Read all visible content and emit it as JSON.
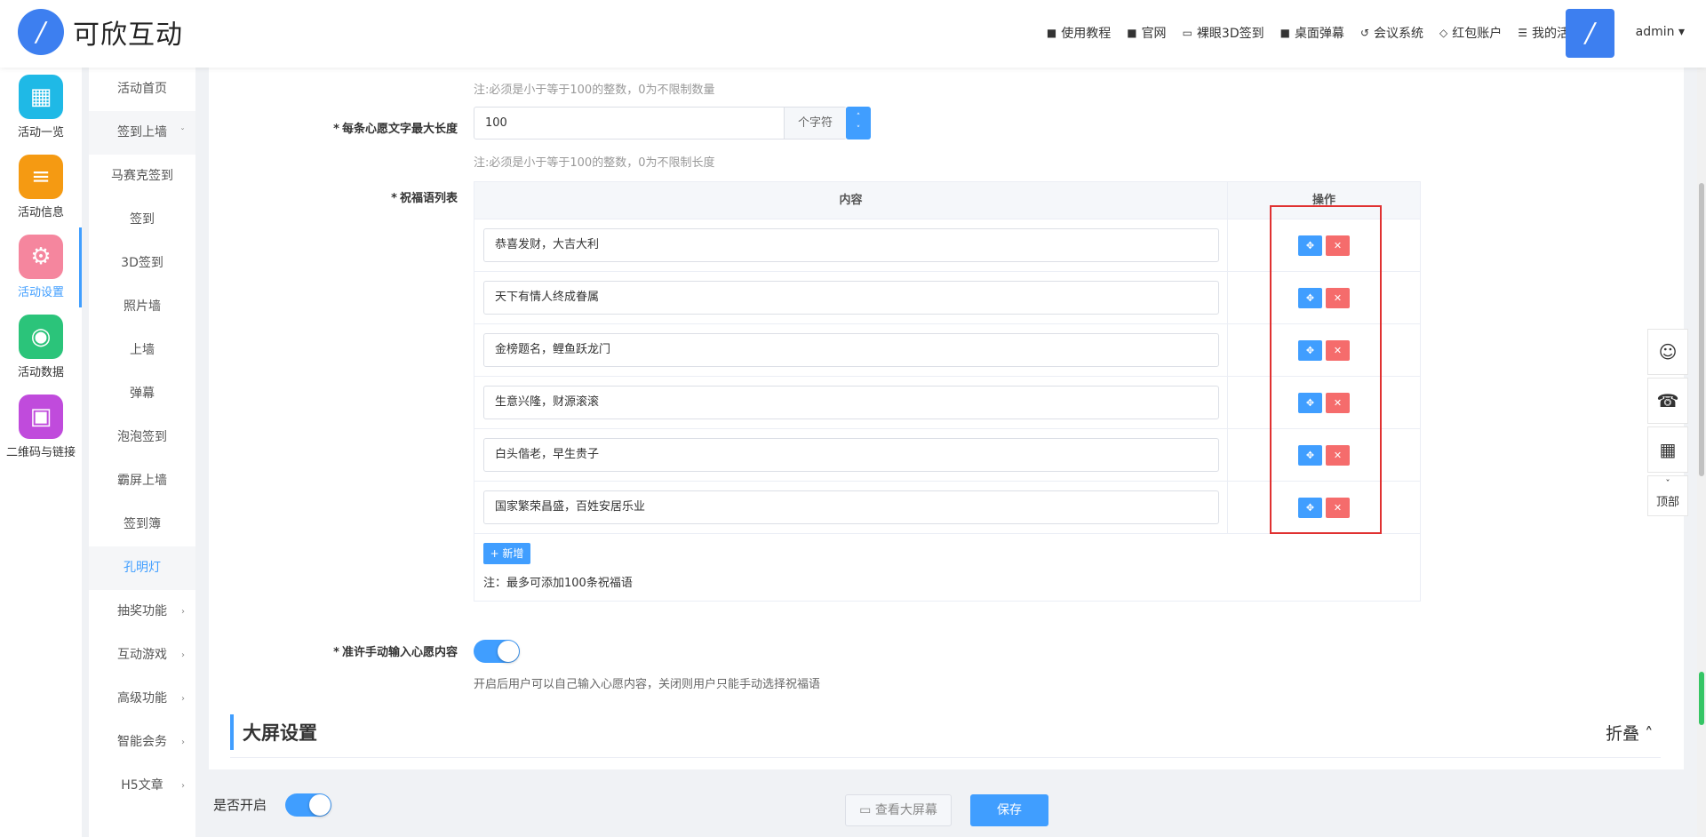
{
  "header": {
    "logo_glyph": "∕",
    "brand": "可欣互动",
    "nav": [
      {
        "icon": "document-icon",
        "glyph": "■",
        "label": "使用教程"
      },
      {
        "icon": "document-icon",
        "glyph": "■",
        "label": "官网"
      },
      {
        "icon": "monitor-icon",
        "glyph": "▭",
        "label": "裸眼3D签到"
      },
      {
        "icon": "document-icon",
        "glyph": "■",
        "label": "桌面弹幕"
      },
      {
        "icon": "meeting-icon",
        "glyph": "↺",
        "label": "会议系统"
      },
      {
        "icon": "diamond-icon",
        "glyph": "◇",
        "label": "红包账户"
      },
      {
        "icon": "list-icon",
        "glyph": "☰",
        "label": "我的活动"
      }
    ],
    "admin": "admin ▾"
  },
  "sidebar1": [
    {
      "label": "活动一览",
      "color": "#1fb9e6",
      "glyph": "▦",
      "icon": "grid-icon"
    },
    {
      "label": "活动信息",
      "color": "#f59a12",
      "glyph": "≡",
      "icon": "document-icon"
    },
    {
      "label": "活动设置",
      "color": "#f5869e",
      "glyph": "⚙",
      "icon": "gear-icon"
    },
    {
      "label": "活动数据",
      "color": "#2bc47a",
      "glyph": "◉",
      "icon": "database-icon"
    },
    {
      "label": "二维码与链接",
      "color": "#c04bdc",
      "glyph": "▣",
      "icon": "qrcode-icon"
    }
  ],
  "sidebar2": [
    {
      "label": "活动首页",
      "arrow": ""
    },
    {
      "label": "签到上墙",
      "arrow": "ˇ"
    },
    {
      "label": "马赛克签到",
      "arrow": ""
    },
    {
      "label": "签到",
      "arrow": ""
    },
    {
      "label": "3D签到",
      "arrow": ""
    },
    {
      "label": "照片墙",
      "arrow": ""
    },
    {
      "label": "上墙",
      "arrow": ""
    },
    {
      "label": "弹幕",
      "arrow": ""
    },
    {
      "label": "泡泡签到",
      "arrow": ""
    },
    {
      "label": "霸屏上墙",
      "arrow": ""
    },
    {
      "label": "签到簿",
      "arrow": ""
    },
    {
      "label": "孔明灯",
      "arrow": ""
    },
    {
      "label": "抽奖功能",
      "arrow": "›"
    },
    {
      "label": "互动游戏",
      "arrow": "›"
    },
    {
      "label": "高级功能",
      "arrow": "›"
    },
    {
      "label": "智能会务",
      "arrow": "›"
    },
    {
      "label": "H5文章",
      "arrow": "›"
    }
  ],
  "form": {
    "note_count": "注:必须是小于等于100的整数，0为不限制数量",
    "len_label": "每条心愿文字最大长度",
    "len_value": "100",
    "len_unit": "个字符",
    "len_spin_up": "˄",
    "len_spin_down": "˅",
    "note_len": "注:必须是小于等于100的整数，0为不限制长度",
    "list_label": "祝福语列表",
    "col_content": "内容",
    "col_op": "操作",
    "move_glyph": "✥",
    "del_glyph": "✕",
    "rows": [
      "恭喜发财，大吉大利",
      "天下有情人终成眷属",
      "金榜题名，鲤鱼跃龙门",
      "生意兴隆，财源滚滚",
      "白头偕老，早生贵子",
      "国家繁荣昌盛，百姓安居乐业"
    ],
    "add_btn": "+ 新增",
    "list_note": "注：最多可添加100条祝福语",
    "manual_label": "准许手动输入心愿内容",
    "manual_note": "开启后用户可以自己输入心愿内容，关闭则用户只能手动选择祝福语"
  },
  "section": {
    "title": "大屏设置",
    "fold": "折叠 ˄"
  },
  "bottom": {
    "enable_label": "是否开启",
    "view_btn": "▭ 查看大屏幕",
    "save_btn": "保存"
  },
  "float": {
    "qq_glyph": "☺",
    "phone_glyph": "☎",
    "qr_glyph": "▦",
    "top_arrow": "ˇ",
    "top_label": "顶部"
  }
}
